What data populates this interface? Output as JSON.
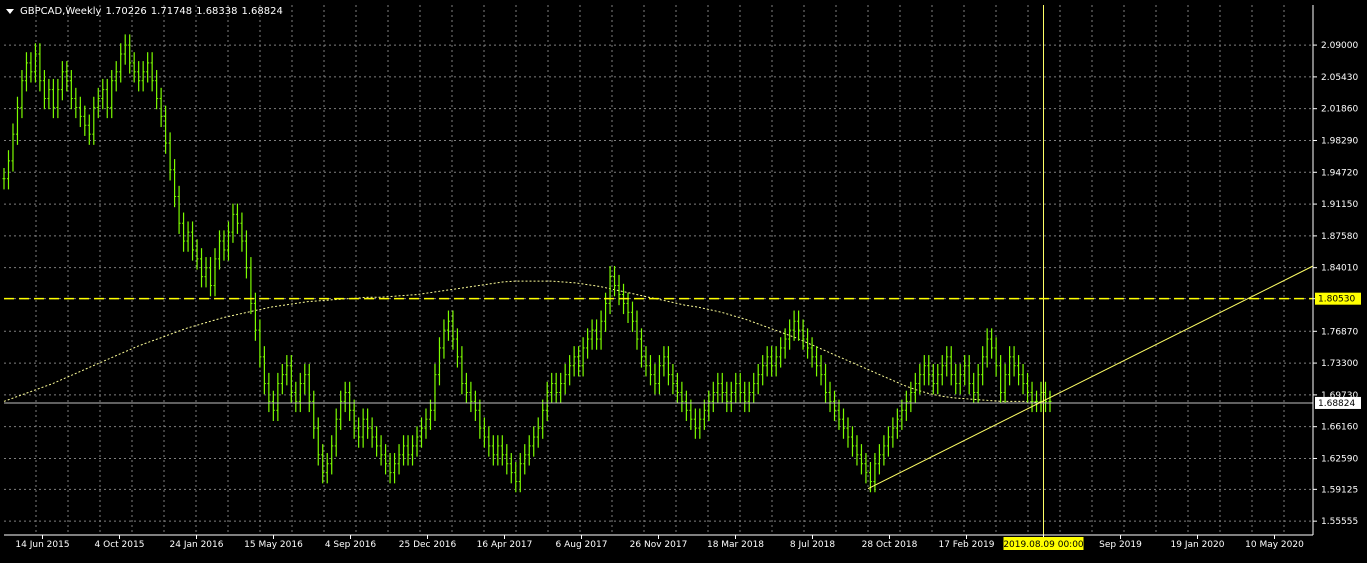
{
  "header": {
    "symbol": "GBPCAD,Weekly",
    "open": "1.70226",
    "high": "1.71748",
    "low": "1.68338",
    "close": "1.68824"
  },
  "colors": {
    "background": "#000000",
    "bars": "#7CFC00",
    "grid": "#7f7f7f",
    "axis_text": "#ffffff",
    "hline": "#ffff00",
    "trendline": "#ffff66",
    "ma": "#ffff99",
    "current_price_line": "#c0c0c0",
    "cursor_label_bg": "#ffff00"
  },
  "chart_data": {
    "type": "line",
    "title": "GBPCAD,Weekly",
    "ylim": [
      1.54,
      2.135
    ],
    "y_ticks": [
      "2.09000",
      "2.05430",
      "2.01860",
      "1.98290",
      "1.94720",
      "1.91150",
      "1.87580",
      "1.84010",
      "1.80530",
      "1.76870",
      "1.73300",
      "1.69730",
      "1.66160",
      "1.62590",
      "1.59125",
      "1.55555"
    ],
    "x_ticks": [
      "14 Jun 2015",
      "4 Oct 2015",
      "24 Jan 2016",
      "15 May 2016",
      "4 Sep 2016",
      "25 Dec 2016",
      "16 Apr 2017",
      "6 Aug 2017",
      "26 Nov 2017",
      "18 Mar 2018",
      "8 Jul 2018",
      "28 Oct 2018",
      "17 Feb 2019",
      "2019.08.09 00:00",
      "Sep 2019",
      "19 Jan 2020",
      "10 May 2020"
    ],
    "grid": true,
    "series": [
      {
        "values": [
          1.94,
          1.96,
          1.99,
          2.02,
          2.05,
          2.07,
          2.06,
          2.08,
          2.05,
          2.03,
          2.04,
          2.02,
          2.04,
          2.06,
          2.05,
          2.03,
          2.02,
          2.01,
          2.0,
          1.99,
          2.02,
          2.03,
          2.04,
          2.02,
          2.05,
          2.06,
          2.08,
          2.09,
          2.07,
          2.06,
          2.05,
          2.06,
          2.07,
          2.05,
          2.03,
          2.01,
          1.98,
          1.95,
          1.92,
          1.89,
          1.87,
          1.88,
          1.86,
          1.85,
          1.83,
          1.84,
          1.82,
          1.85,
          1.87,
          1.86,
          1.88,
          1.9,
          1.89,
          1.87,
          1.84,
          1.8,
          1.77,
          1.74,
          1.71,
          1.69,
          1.68,
          1.71,
          1.72,
          1.73,
          1.7,
          1.69,
          1.71,
          1.72,
          1.69,
          1.66,
          1.63,
          1.61,
          1.62,
          1.64,
          1.67,
          1.69,
          1.7,
          1.68,
          1.66,
          1.65,
          1.67,
          1.66,
          1.65,
          1.64,
          1.63,
          1.62,
          1.61,
          1.62,
          1.63,
          1.64,
          1.63,
          1.64,
          1.65,
          1.66,
          1.67,
          1.68,
          1.72,
          1.75,
          1.77,
          1.78,
          1.76,
          1.74,
          1.71,
          1.7,
          1.69,
          1.68,
          1.66,
          1.65,
          1.64,
          1.63,
          1.64,
          1.63,
          1.62,
          1.61,
          1.6,
          1.62,
          1.63,
          1.64,
          1.65,
          1.66,
          1.68,
          1.7,
          1.71,
          1.7,
          1.71,
          1.72,
          1.73,
          1.74,
          1.73,
          1.75,
          1.76,
          1.77,
          1.76,
          1.78,
          1.8,
          1.83,
          1.82,
          1.81,
          1.8,
          1.79,
          1.78,
          1.76,
          1.74,
          1.73,
          1.72,
          1.71,
          1.73,
          1.74,
          1.72,
          1.71,
          1.7,
          1.69,
          1.68,
          1.67,
          1.66,
          1.67,
          1.68,
          1.69,
          1.7,
          1.71,
          1.7,
          1.69,
          1.7,
          1.71,
          1.7,
          1.69,
          1.7,
          1.71,
          1.72,
          1.73,
          1.74,
          1.73,
          1.74,
          1.75,
          1.76,
          1.77,
          1.78,
          1.77,
          1.76,
          1.75,
          1.74,
          1.73,
          1.72,
          1.7,
          1.69,
          1.68,
          1.67,
          1.66,
          1.65,
          1.64,
          1.63,
          1.62,
          1.61,
          1.6,
          1.62,
          1.63,
          1.64,
          1.65,
          1.66,
          1.67,
          1.68,
          1.69,
          1.7,
          1.71,
          1.72,
          1.73,
          1.72,
          1.71,
          1.72,
          1.73,
          1.74,
          1.72,
          1.71,
          1.72,
          1.73,
          1.71,
          1.7,
          1.72,
          1.74,
          1.76,
          1.75,
          1.73,
          1.7,
          1.72,
          1.74,
          1.73,
          1.72,
          1.71,
          1.7,
          1.69,
          1.69,
          1.7,
          1.69,
          1.69
        ]
      },
      {
        "name": "",
        "values": [
          1.69,
          1.695,
          1.7,
          1.705,
          1.71,
          1.716,
          1.722,
          1.728,
          1.734,
          1.74,
          1.746,
          1.752,
          1.757,
          1.762,
          1.767,
          1.772,
          1.776,
          1.78,
          1.784,
          1.787,
          1.79,
          1.793,
          1.796,
          1.798,
          1.8,
          1.802,
          1.803,
          1.804,
          1.805,
          1.806,
          1.807,
          1.807,
          1.808,
          1.809,
          1.81,
          1.812,
          1.814,
          1.816,
          1.818,
          1.82,
          1.822,
          1.824,
          1.825,
          1.825,
          1.825,
          1.825,
          1.824,
          1.823,
          1.821,
          1.819,
          1.816,
          1.813,
          1.81,
          1.807,
          1.804,
          1.801,
          1.798,
          1.796,
          1.793,
          1.79,
          1.786,
          1.782,
          1.777,
          1.772,
          1.767,
          1.762,
          1.756,
          1.75,
          1.744,
          1.738,
          1.732,
          1.726,
          1.72,
          1.714,
          1.708,
          1.703,
          1.699,
          1.696,
          1.694,
          1.693,
          1.692,
          1.691,
          1.69,
          1.69,
          1.69,
          1.689,
          1.688
        ]
      }
    ],
    "hline": "1.80530",
    "current_price": "1.68824",
    "cursor_label": "2019.08.09 00:00"
  }
}
